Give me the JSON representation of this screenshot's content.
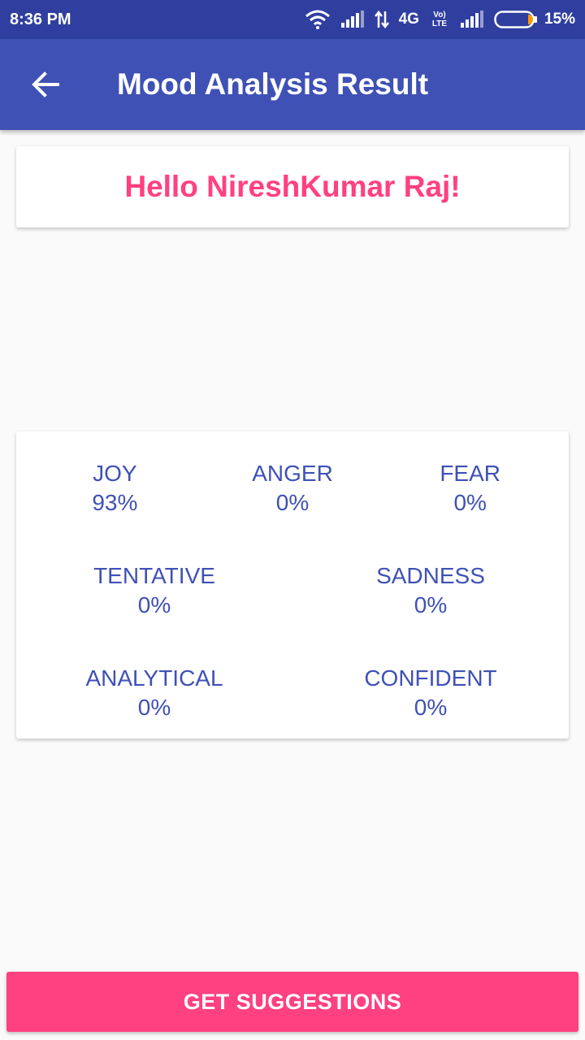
{
  "status_bar": {
    "time": "8:36 PM",
    "network": "4G",
    "volte": "Vo) LTE",
    "battery_percent": "15%",
    "icons": [
      "wifi-icon",
      "signal-icon",
      "data-arrows-icon",
      "signal-icon",
      "battery-icon"
    ]
  },
  "app_bar": {
    "title": "Mood Analysis Result",
    "back_icon": "arrow-left-icon"
  },
  "greeting": {
    "text": "Hello NireshKumar Raj!"
  },
  "moods": {
    "joy": {
      "label": "JOY",
      "value": "93%"
    },
    "anger": {
      "label": "ANGER",
      "value": "0%"
    },
    "fear": {
      "label": "FEAR",
      "value": "0%"
    },
    "tentative": {
      "label": "TENTATIVE",
      "value": "0%"
    },
    "sadness": {
      "label": "SADNESS",
      "value": "0%"
    },
    "analytical": {
      "label": "ANALYTICAL",
      "value": "0%"
    },
    "confident": {
      "label": "CONFIDENT",
      "value": "0%"
    }
  },
  "actions": {
    "get_suggestions": "GET SUGGESTIONS"
  },
  "colors": {
    "status_bar": "#303f9f",
    "primary": "#3f51b5",
    "accent": "#ff4081",
    "background": "#fafafa",
    "battery_level": "#ff9800"
  }
}
